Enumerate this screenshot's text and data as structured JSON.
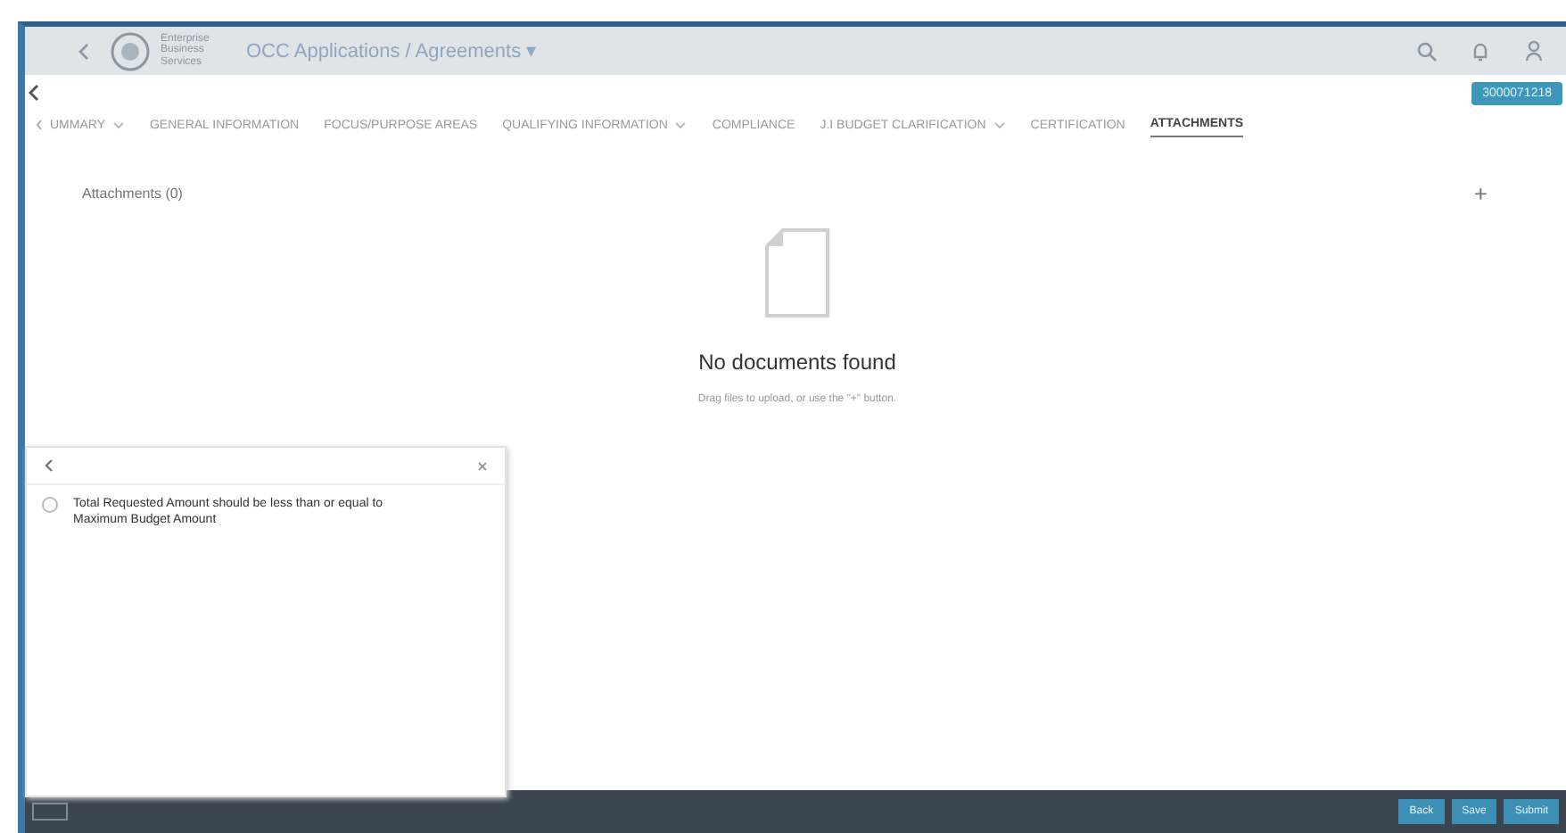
{
  "header": {
    "title": "OCC Applications / Agreements ▾",
    "logo_text": "Enterprise Business Services"
  },
  "record_badge": "3000071218",
  "tabs": [
    {
      "label": "UMMARY",
      "selected": false,
      "has_menu": true
    },
    {
      "label": "GENERAL INFORMATION",
      "selected": false,
      "has_menu": false
    },
    {
      "label": "FOCUS/PURPOSE AREAS",
      "selected": false,
      "has_menu": false
    },
    {
      "label": "QUALIFYING INFORMATION",
      "selected": false,
      "has_menu": true
    },
    {
      "label": "COMPLIANCE",
      "selected": false,
      "has_menu": false
    },
    {
      "label": "J.I BUDGET CLARIFICATION",
      "selected": false,
      "has_menu": true
    },
    {
      "label": "CERTIFICATION",
      "selected": false,
      "has_menu": false
    },
    {
      "label": "ATTACHMENTS",
      "selected": true,
      "has_menu": false
    }
  ],
  "attachments": {
    "heading": "Attachments (0)",
    "add": "+",
    "empty_title": "No documents found",
    "empty_hint": "Drag files to upload, or use the \"+\" button."
  },
  "messages": [
    {
      "text": "Total Requested Amount should be less than or equal to Maximum Budget Amount"
    }
  ],
  "footer_buttons": [
    "Back",
    "Save",
    "Submit"
  ]
}
